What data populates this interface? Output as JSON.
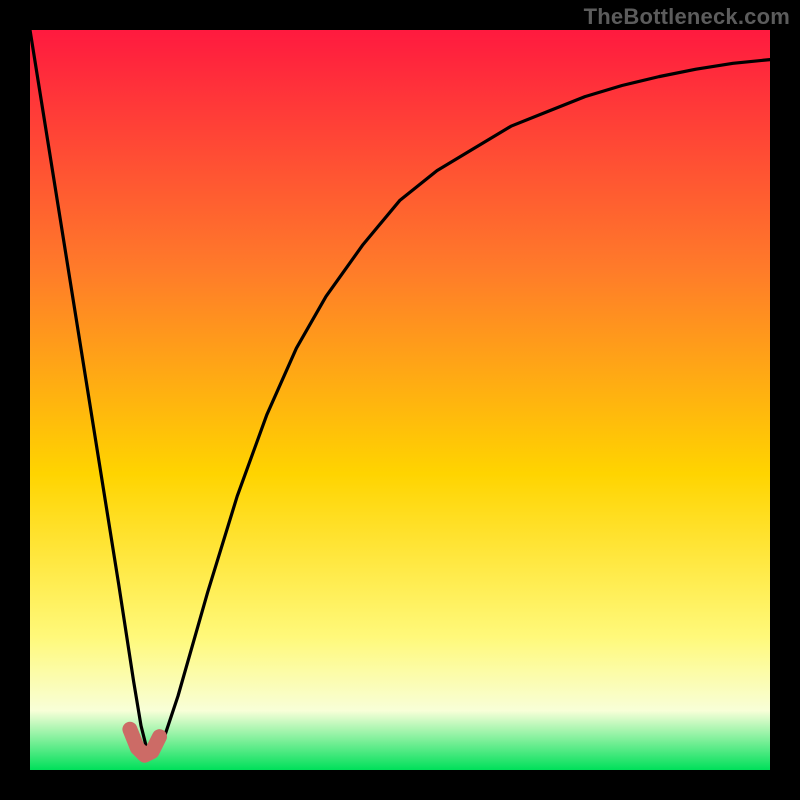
{
  "watermark": "TheBottleneck.com",
  "colors": {
    "background_black": "#000000",
    "gradient_top": "#ff1a3f",
    "gradient_mid_upper": "#ff7a2a",
    "gradient_mid": "#ffd400",
    "gradient_lower": "#fff97a",
    "gradient_pale": "#f8ffd8",
    "gradient_bottom": "#00e05a",
    "curve_stroke": "#000000",
    "marker_fill": "#cc6b66"
  },
  "chart_data": {
    "type": "line",
    "title": "",
    "xlabel": "",
    "ylabel": "",
    "xlim": [
      0,
      100
    ],
    "ylim": [
      0,
      100
    ],
    "series": [
      {
        "name": "bottleneck-curve",
        "x": [
          0,
          4,
          8,
          12,
          14,
          15,
          16,
          17,
          18,
          20,
          24,
          28,
          32,
          36,
          40,
          45,
          50,
          55,
          60,
          65,
          70,
          75,
          80,
          85,
          90,
          95,
          100
        ],
        "values": [
          100,
          75,
          50,
          25,
          12,
          6,
          2,
          2,
          4,
          10,
          24,
          37,
          48,
          57,
          64,
          71,
          77,
          81,
          84,
          87,
          89,
          91,
          92.5,
          93.7,
          94.7,
          95.5,
          96
        ]
      }
    ],
    "marker": {
      "name": "minimum-region",
      "x": [
        13.5,
        14.5,
        15.5,
        16.5,
        17.5
      ],
      "values": [
        5.5,
        3.0,
        2.0,
        2.5,
        4.5
      ]
    }
  }
}
